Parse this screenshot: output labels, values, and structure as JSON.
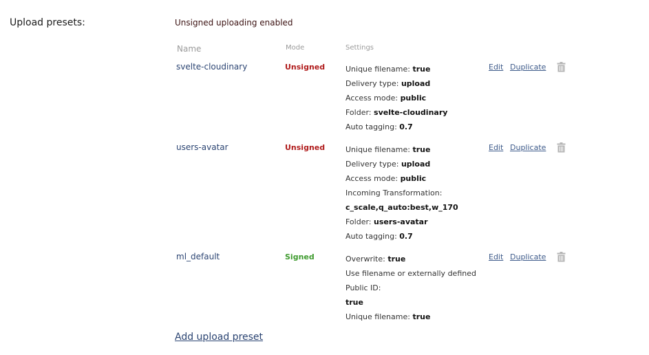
{
  "section_label": "Upload presets:",
  "status_text": "Unsigned uploading enabled",
  "columns": {
    "name": "Name",
    "mode": "Mode",
    "settings": "Settings"
  },
  "presets": [
    {
      "name": "svelte-cloudinary",
      "mode": "Unsigned",
      "mode_color": "#b01c1c",
      "settings": [
        {
          "label": "Unique filename: ",
          "value": "true"
        },
        {
          "label": "Delivery type: ",
          "value": "upload"
        },
        {
          "label": "Access mode: ",
          "value": "public"
        },
        {
          "label": "Folder: ",
          "value": "svelte-cloudinary"
        },
        {
          "label": "Auto tagging: ",
          "value": "0.7"
        }
      ],
      "edit_label": "Edit",
      "duplicate_label": "Duplicate"
    },
    {
      "name": "users-avatar",
      "mode": "Unsigned",
      "mode_color": "#b01c1c",
      "settings": [
        {
          "label": "Unique filename: ",
          "value": "true"
        },
        {
          "label": "Delivery type: ",
          "value": "upload"
        },
        {
          "label": "Access mode: ",
          "value": "public"
        },
        {
          "label": "Incoming Transformation:",
          "value": ""
        },
        {
          "label": "",
          "value": "c_scale,q_auto:best,w_170"
        },
        {
          "label": "Folder: ",
          "value": "users-avatar"
        },
        {
          "label": "Auto tagging: ",
          "value": "0.7"
        }
      ],
      "edit_label": "Edit",
      "duplicate_label": "Duplicate"
    },
    {
      "name": "ml_default",
      "mode": "Signed",
      "mode_color": "#3f9b2f",
      "settings": [
        {
          "label": "Overwrite: ",
          "value": "true"
        },
        {
          "label": "Use filename or externally defined",
          "value": ""
        },
        {
          "label": "Public ID:",
          "value": ""
        },
        {
          "label": "",
          "value": "true"
        },
        {
          "label": "Unique filename: ",
          "value": "true"
        }
      ],
      "edit_label": "Edit",
      "duplicate_label": "Duplicate"
    }
  ],
  "add_preset_label": "Add upload preset",
  "icons": {
    "delete": "trash-icon"
  },
  "colors": {
    "link": "#2b4472",
    "unsigned": "#b01c1c",
    "signed": "#3f9b2f",
    "muted_header": "#9a9a9a"
  }
}
